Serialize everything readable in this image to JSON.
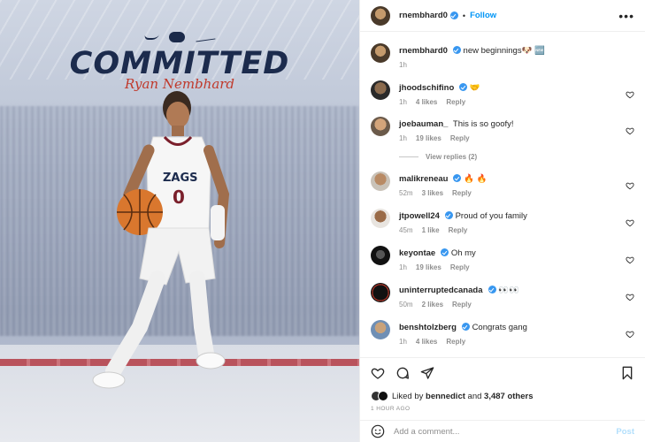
{
  "post": {
    "author": "rnembhard0",
    "follow_label": "Follow",
    "dot": "•",
    "more": "•••",
    "caption": "new beginnings🐶 🆕",
    "caption_time": "1h"
  },
  "media": {
    "headline": "COMMITTED",
    "signature_script": "Ryan Nembhard"
  },
  "comments": [
    {
      "user": "jhoodschifino",
      "text": "🤝",
      "time": "1h",
      "likes": "4 likes",
      "reply": "Reply",
      "verified": true
    },
    {
      "user": "joebauman_",
      "text": "This is so goofy!",
      "time": "1h",
      "likes": "19 likes",
      "reply": "Reply",
      "verified": false
    },
    {
      "user": "malikreneau",
      "text": "🔥 🔥",
      "time": "52m",
      "likes": "3 likes",
      "reply": "Reply",
      "verified": true
    },
    {
      "user": "jtpowell24",
      "text": "Proud of you family",
      "time": "45m",
      "likes": "1 like",
      "reply": "Reply",
      "verified": true
    },
    {
      "user": "keyontae",
      "text": "Oh my",
      "time": "1h",
      "likes": "19 likes",
      "reply": "Reply",
      "verified": true
    },
    {
      "user": "uninterruptedcanada",
      "text": "👀👀",
      "time": "50m",
      "likes": "2 likes",
      "reply": "Reply",
      "verified": true
    },
    {
      "user": "benshtolzberg",
      "text": "Congrats gang",
      "time": "1h",
      "likes": "4 likes",
      "reply": "Reply",
      "verified": true
    }
  ],
  "view_replies": "View replies (2)",
  "likes_line": {
    "prefix": "Liked by",
    "user": "bennedict",
    "and": "and",
    "others": "3,487 others"
  },
  "timestamp": "1 HOUR AGO",
  "add_comment": {
    "placeholder": "Add a comment...",
    "post_label": "Post"
  },
  "colors": {
    "accent": "#0095f6",
    "verified": "#3897f0",
    "muted": "#8e8e8e",
    "brand_navy": "#1c2b4d",
    "brand_red": "#c0392b"
  },
  "icons": [
    "heart-icon",
    "comment-icon",
    "share-icon",
    "bookmark-icon",
    "emoji-icon",
    "more-icon",
    "verified-icon"
  ]
}
